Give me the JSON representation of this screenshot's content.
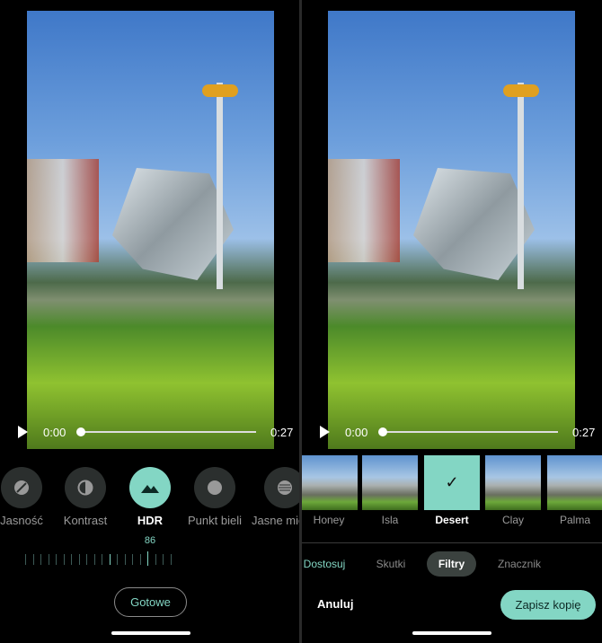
{
  "left": {
    "player": {
      "current_time": "0:00",
      "duration": "0:27",
      "progress": 0
    },
    "tools": [
      {
        "label": "Jasność",
        "icon": "brightness-icon",
        "selected": false
      },
      {
        "label": "Kontrast",
        "icon": "contrast-icon",
        "selected": false
      },
      {
        "label": "HDR",
        "icon": "mountain-icon",
        "selected": true
      },
      {
        "label": "Punkt bieli",
        "icon": "white-point-icon",
        "selected": false
      },
      {
        "label": "Jasne mie",
        "icon": "highlights-icon",
        "selected": false
      }
    ],
    "slider_value": "86",
    "done_label": "Gotowe"
  },
  "right": {
    "player": {
      "current_time": "0:00",
      "duration": "0:27",
      "progress": 0
    },
    "filters": [
      {
        "label": "Honey",
        "selected": false
      },
      {
        "label": "Isla",
        "selected": false
      },
      {
        "label": "Desert",
        "selected": true
      },
      {
        "label": "Clay",
        "selected": false
      },
      {
        "label": "Palma",
        "selected": false
      }
    ],
    "tabs": [
      {
        "label": "Dostosuj"
      },
      {
        "label": "Skutki"
      },
      {
        "label": "Filtry",
        "selected": true
      },
      {
        "label": "Znacznik"
      }
    ],
    "cancel_label": "Anuluj",
    "save_label": "Zapisz kopię"
  },
  "colors": {
    "accent": "#83d6c4",
    "pill": "#3b423f"
  }
}
